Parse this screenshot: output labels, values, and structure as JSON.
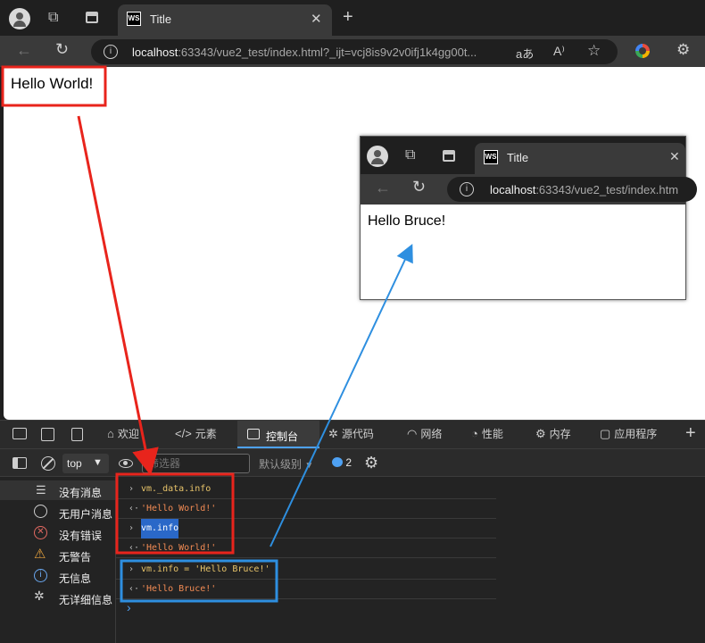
{
  "browser": {
    "tab_title": "Title",
    "tab_icon": "WS",
    "url_host": "localhost",
    "url_rest": ":63343/vue2_test/index.html?_ijt=vcj8is9v2v0ifj1k4gg00t...",
    "read_aloud_label": "aあ"
  },
  "page": {
    "heading": "Hello World!"
  },
  "inset_browser": {
    "tab_title": "Title",
    "tab_icon": "WS",
    "url_host": "localhost",
    "url_rest": ":63343/vue2_test/index.htm",
    "page_text": "Hello Bruce!"
  },
  "devtools": {
    "tabs": [
      {
        "label": "欢迎",
        "icon": "home-icon"
      },
      {
        "label": "元素",
        "icon": "code-icon"
      },
      {
        "label": "控制台",
        "icon": "console-icon"
      },
      {
        "label": "源代码",
        "icon": "bug-icon"
      },
      {
        "label": "网络",
        "icon": "wifi-icon"
      },
      {
        "label": "性能",
        "icon": "gauge-icon"
      },
      {
        "label": "内存",
        "icon": "chip-icon"
      },
      {
        "label": "应用程序",
        "icon": "app-icon"
      }
    ],
    "context_select": "top",
    "filter_placeholder": "筛选器",
    "level_select": "默认级别",
    "message_count": "2",
    "sidebar": [
      {
        "label": "没有消息",
        "icon": "list-icon"
      },
      {
        "label": "无用户消息",
        "icon": "user-icon"
      },
      {
        "label": "没有错误",
        "icon": "error-icon"
      },
      {
        "label": "无警告",
        "icon": "warning-icon"
      },
      {
        "label": "无信息",
        "icon": "info-icon"
      },
      {
        "label": "无详细信息",
        "icon": "verbose-icon"
      }
    ],
    "console_lines": [
      {
        "dir": "input",
        "text": "vm._data.info"
      },
      {
        "dir": "output",
        "text": "'Hello World!'"
      },
      {
        "dir": "input",
        "text": "vm.info"
      },
      {
        "dir": "output",
        "text": "'Hello World!'"
      },
      {
        "dir": "input",
        "text": "vm.info = 'Hello Bruce!'"
      },
      {
        "dir": "output",
        "text": "'Hello Bruce!'"
      }
    ]
  },
  "colors": {
    "annotation_red": "#e8241c",
    "annotation_blue": "#2e8fe0",
    "console_string": "#f28b54",
    "console_code": "#e8c46a",
    "accent": "#4ea1f3"
  }
}
